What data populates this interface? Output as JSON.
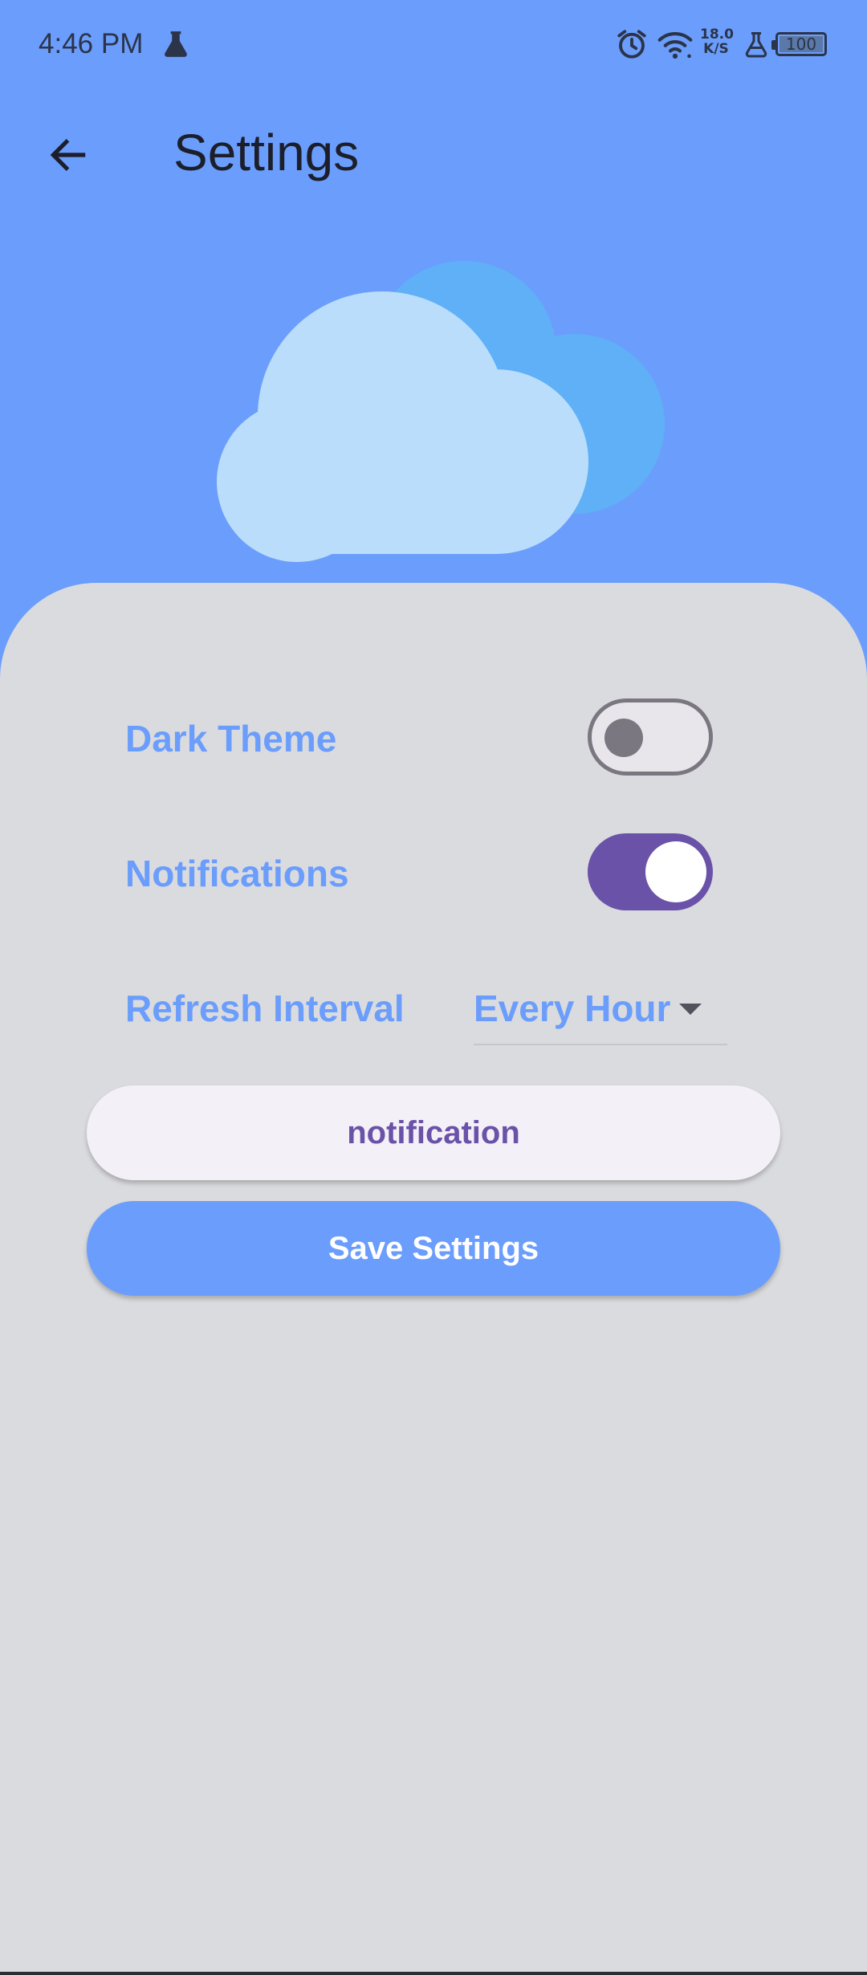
{
  "status_bar": {
    "time": "4:46 PM",
    "net_speed_value": "18.0",
    "net_speed_unit": "K/S",
    "battery": "100",
    "icons": [
      "flask-icon",
      "alarm-icon",
      "wifi-icon",
      "flask-icon",
      "battery-icon"
    ]
  },
  "app_bar": {
    "title": "Settings",
    "back_icon": "arrow-left-icon"
  },
  "hero": {
    "icon": "cloud-icon"
  },
  "settings": {
    "dark_theme": {
      "label": "Dark Theme",
      "enabled": false
    },
    "notifications": {
      "label": "Notifications",
      "enabled": true
    },
    "refresh_interval": {
      "label": "Refresh Interval",
      "value": "Every Hour"
    }
  },
  "buttons": {
    "notification": "notification",
    "save": "Save Settings"
  },
  "colors": {
    "background": "#6b9dfc",
    "card": "#dadbde",
    "accent": "#6b9dfc",
    "switch_on": "#6a52a8",
    "cloud_front": "#b9ddfa",
    "cloud_back": "#5fb0f6"
  }
}
